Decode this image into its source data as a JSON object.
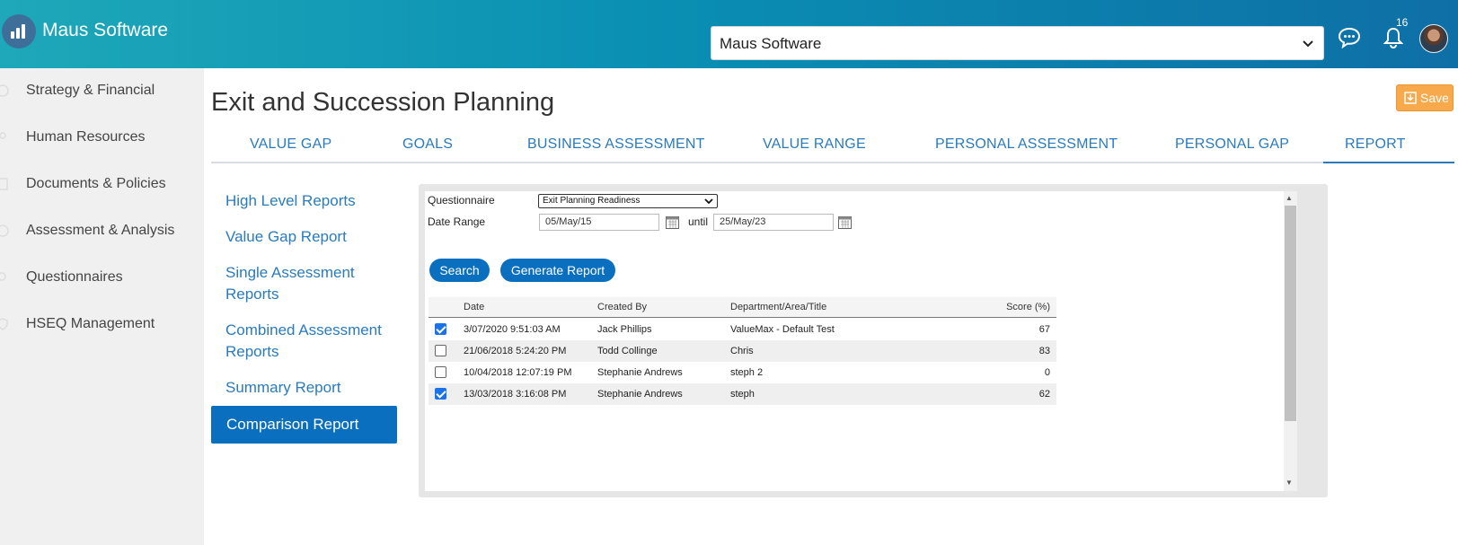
{
  "header": {
    "brand": "Maus Software",
    "company_select": "Maus Software",
    "notification_count": "16"
  },
  "sidebar": {
    "items": [
      {
        "label": "Strategy & Financial",
        "icon": "dollar-icon"
      },
      {
        "label": "Human Resources",
        "icon": "person-icon"
      },
      {
        "label": "Documents & Policies",
        "icon": "document-icon"
      },
      {
        "label": "Assessment & Analysis",
        "icon": "dollar-icon"
      },
      {
        "label": "Questionnaires",
        "icon": "search-icon"
      },
      {
        "label": "HSEQ Management",
        "icon": "shield-icon"
      }
    ]
  },
  "page": {
    "title": "Exit and Succession Planning",
    "save_label": "Save"
  },
  "tabs": [
    {
      "label": "VALUE GAP"
    },
    {
      "label": "GOALS"
    },
    {
      "label": "BUSINESS ASSESSMENT"
    },
    {
      "label": "VALUE RANGE"
    },
    {
      "label": "PERSONAL ASSESSMENT"
    },
    {
      "label": "PERSONAL GAP"
    },
    {
      "label": "REPORT",
      "active": true
    }
  ],
  "report_nav": {
    "items": [
      {
        "label": "High Level Reports"
      },
      {
        "label": "Value Gap Report"
      },
      {
        "label": "Single Assessment Reports"
      },
      {
        "label": "Combined Assessment Reports"
      },
      {
        "label": "Summary Report"
      }
    ],
    "active": "Comparison Report"
  },
  "form": {
    "questionnaire_label": "Questionnaire",
    "questionnaire_value": "Exit Planning Readiness",
    "date_range_label": "Date Range",
    "date_from": "05/May/15",
    "until_label": "until",
    "date_to": "25/May/23",
    "search_label": "Search",
    "generate_label": "Generate Report"
  },
  "table": {
    "headers": [
      "Date",
      "Created By",
      "Department/Area/Title",
      "Score (%)"
    ],
    "rows": [
      {
        "checked": true,
        "date": "3/07/2020 9:51:03 AM",
        "created_by": "Jack Phillips",
        "department": "ValueMax - Default Test",
        "score": "67"
      },
      {
        "checked": false,
        "date": "21/06/2018 5:24:20 PM",
        "created_by": "Todd Collinge",
        "department": "Chris",
        "score": "83"
      },
      {
        "checked": false,
        "date": "10/04/2018 12:07:19 PM",
        "created_by": "Stephanie Andrews",
        "department": "steph 2",
        "score": "0"
      },
      {
        "checked": true,
        "date": "13/03/2018 3:16:08 PM",
        "created_by": "Stephanie Andrews",
        "department": "steph",
        "score": "62"
      }
    ]
  },
  "colors": {
    "accent": "#0b6fbf",
    "link": "#2a7bbd",
    "save": "#f7a94c"
  }
}
